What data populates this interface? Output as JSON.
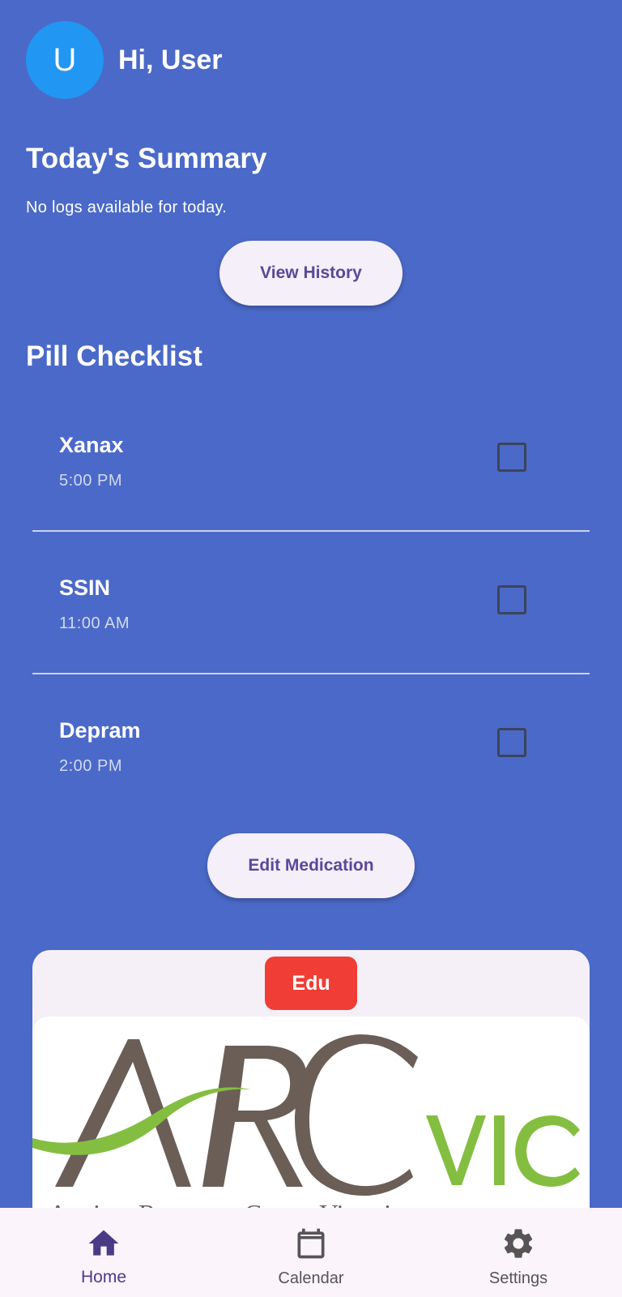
{
  "header": {
    "avatar_initial": "U",
    "greeting": "Hi, User"
  },
  "summary": {
    "title": "Today's Summary",
    "message": "No logs available for today.",
    "view_history_label": "View History"
  },
  "checklist": {
    "title": "Pill Checklist",
    "items": [
      {
        "name": "Xanax",
        "time": "5:00 PM",
        "checked": false
      },
      {
        "name": "SSIN",
        "time": "11:00 AM",
        "checked": false
      },
      {
        "name": "Depram",
        "time": "2:00 PM",
        "checked": false
      }
    ],
    "edit_label": "Edit Medication"
  },
  "edu_card": {
    "badge": "Edu",
    "logo_text": "ARCvic",
    "logo_subtitle": "Anxiety Recovery Centre Victoria"
  },
  "bottom_nav": {
    "items": [
      {
        "label": "Home",
        "icon": "home-icon",
        "active": true
      },
      {
        "label": "Calendar",
        "icon": "calendar-icon",
        "active": false
      },
      {
        "label": "Settings",
        "icon": "gear-icon",
        "active": false
      }
    ]
  },
  "colors": {
    "background": "#4B69C8",
    "avatar": "#2196F3",
    "button_bg": "#F4EFF8",
    "button_text": "#5A479A",
    "edu_badge": "#F03E36",
    "nav_active": "#4A3B87"
  }
}
